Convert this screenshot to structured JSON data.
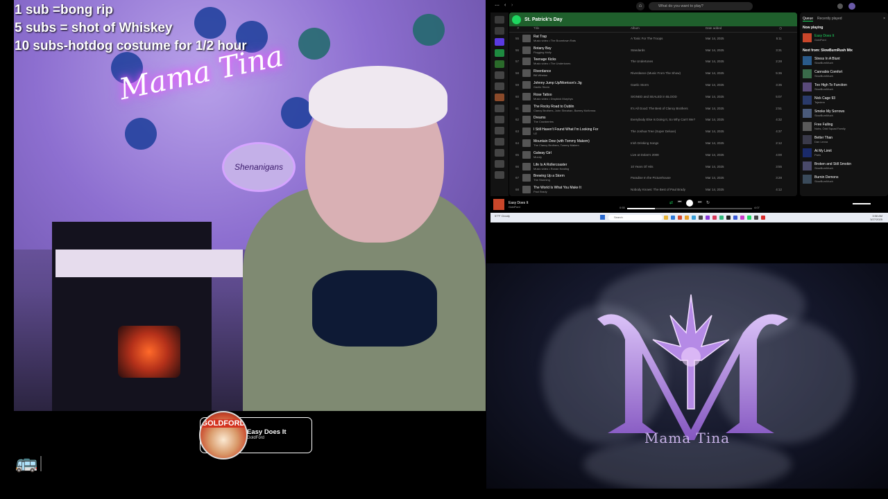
{
  "overlay": {
    "line1": "1 sub   =bong rip",
    "line2": "5 subs = shot of Whiskey",
    "line3": "10 subs-hotdog costume for 1/2 hour"
  },
  "webcam": {
    "neon_sign": "Mama Tina",
    "hanging_sign": "Shenanigans"
  },
  "now_playing": {
    "album_label": "GOLDFORD",
    "title": "Easy Does It",
    "artist": "GoldFord"
  },
  "spotify": {
    "search_placeholder": "What do you want to play?",
    "playlist_title": "St. Patrick's Day",
    "columns": {
      "num": "#",
      "title": "Title",
      "album": "Album",
      "date": "Date added"
    },
    "tracks": [
      {
        "num": "55",
        "title": "Rat Trap",
        "artist": "Music video • The Boomtown Rats",
        "album": "A Tonic For The Troops",
        "date": "Mar 14, 2025",
        "dur": "5:11"
      },
      {
        "num": "56",
        "title": "Botany Bay",
        "artist": "Flogging Molly",
        "album": "Standards",
        "date": "Mar 14, 2025",
        "dur": "3:31"
      },
      {
        "num": "57",
        "title": "Teenage Kicks",
        "artist": "Music video • The Undertones",
        "album": "The Undertones",
        "date": "Mar 14, 2025",
        "dur": "2:28"
      },
      {
        "num": "58",
        "title": "Riverdance",
        "artist": "Bill Whelan",
        "album": "Riverdance (Music From The Show)",
        "date": "Mar 14, 2025",
        "dur": "5:36"
      },
      {
        "num": "59",
        "title": "Johnny Jump Up/Morrison's Jig",
        "artist": "Gaelic Storm",
        "album": "Gaelic Storm",
        "date": "Mar 14, 2025",
        "dur": "3:35"
      },
      {
        "num": "60",
        "title": "Rose Tattoo",
        "artist": "Music video • Dropkick Murphys",
        "album": "SIGNED and SEALED in BLOOD",
        "date": "Mar 14, 2025",
        "dur": "5:07"
      },
      {
        "num": "61",
        "title": "The Rocky Road to Dublin",
        "artist": "Clancy Brothers, John Sheahan, Barney McKenna",
        "album": "It's All Good: The Best of Clancy Brothers",
        "date": "Mar 14, 2025",
        "dur": "2:51"
      },
      {
        "num": "62",
        "title": "Dreams",
        "artist": "The Cranberries",
        "album": "Everybody Else Is Doing It, So Why Can't We?",
        "date": "Mar 14, 2025",
        "dur": "4:32"
      },
      {
        "num": "63",
        "title": "I Still Haven't Found What I'm Looking For",
        "artist": "U2",
        "album": "The Joshua Tree (Super Deluxe)",
        "date": "Mar 14, 2025",
        "dur": "4:37"
      },
      {
        "num": "64",
        "title": "Mountain Dew (with Tommy Makem)",
        "artist": "The Clancy Brothers, Tommy Makem",
        "album": "Irish Drinking Songs",
        "date": "Mar 14, 2025",
        "dur": "2:12"
      },
      {
        "num": "65",
        "title": "Galway Girl",
        "artist": "Mundy",
        "album": "Live at Dolan's 2008",
        "date": "Mar 14, 2025",
        "dur": "4:00"
      },
      {
        "num": "66",
        "title": "Life Is A Rollercoaster",
        "artist": "Music video • Ronan Keating",
        "album": "10 Years Of Hits",
        "date": "Mar 14, 2025",
        "dur": "3:55"
      },
      {
        "num": "67",
        "title": "Brewing Up a Storm",
        "artist": "The Stunning",
        "album": "Paradise In the Picturehouse",
        "date": "Mar 14, 2025",
        "dur": "3:28"
      },
      {
        "num": "68",
        "title": "The World Is What You Make It",
        "artist": "Paul Brady",
        "album": "Nobody Knows: The Best of Paul Brady",
        "date": "Mar 14, 2025",
        "dur": "4:12"
      }
    ],
    "queue": {
      "tab_queue": "Queue",
      "tab_recent": "Recently played",
      "now_playing_label": "Now playing",
      "current_title": "Easy Does It",
      "current_artist": "GoldFord",
      "next_label": "Next from: SlowBurnRush Mix",
      "items": [
        {
          "title": "Stress In A Blunt",
          "artist": "SlowBurnMuch"
        },
        {
          "title": "Cannabis Comfort",
          "artist": "SlowBurnMuch"
        },
        {
          "title": "Too High To Function",
          "artist": "SlowBurnMuch"
        },
        {
          "title": "Nick Cage 93",
          "artist": "Tsjedem"
        },
        {
          "title": "Smoke My Sorrows",
          "artist": "SlowBurnMuch"
        },
        {
          "title": "Free Falling",
          "artist": "Nubs, Odd Squad Family"
        },
        {
          "title": "Better Than",
          "artist": "Dan Lexxa"
        },
        {
          "title": "At My Limit",
          "artist": "Paris"
        },
        {
          "title": "Broken and Still Smokin",
          "artist": "SlowBurnMuch"
        },
        {
          "title": "Burnin Demons",
          "artist": "SlowBurnMuch"
        }
      ]
    },
    "player": {
      "title": "Easy Does It",
      "artist": "GoldFord",
      "elapsed": "0:55",
      "total": "4:07",
      "progress": 0.22
    }
  },
  "taskbar": {
    "search_placeholder": "Search",
    "weather": "57°F Cloudy",
    "time": "3:58 AM",
    "date": "3/27/2025"
  },
  "logo": {
    "name": "Mama Tina"
  },
  "colors": {
    "spotify_green": "#1ed760",
    "playlist_header": "#1f5f2c",
    "logo_purple": "#b58ae6"
  }
}
